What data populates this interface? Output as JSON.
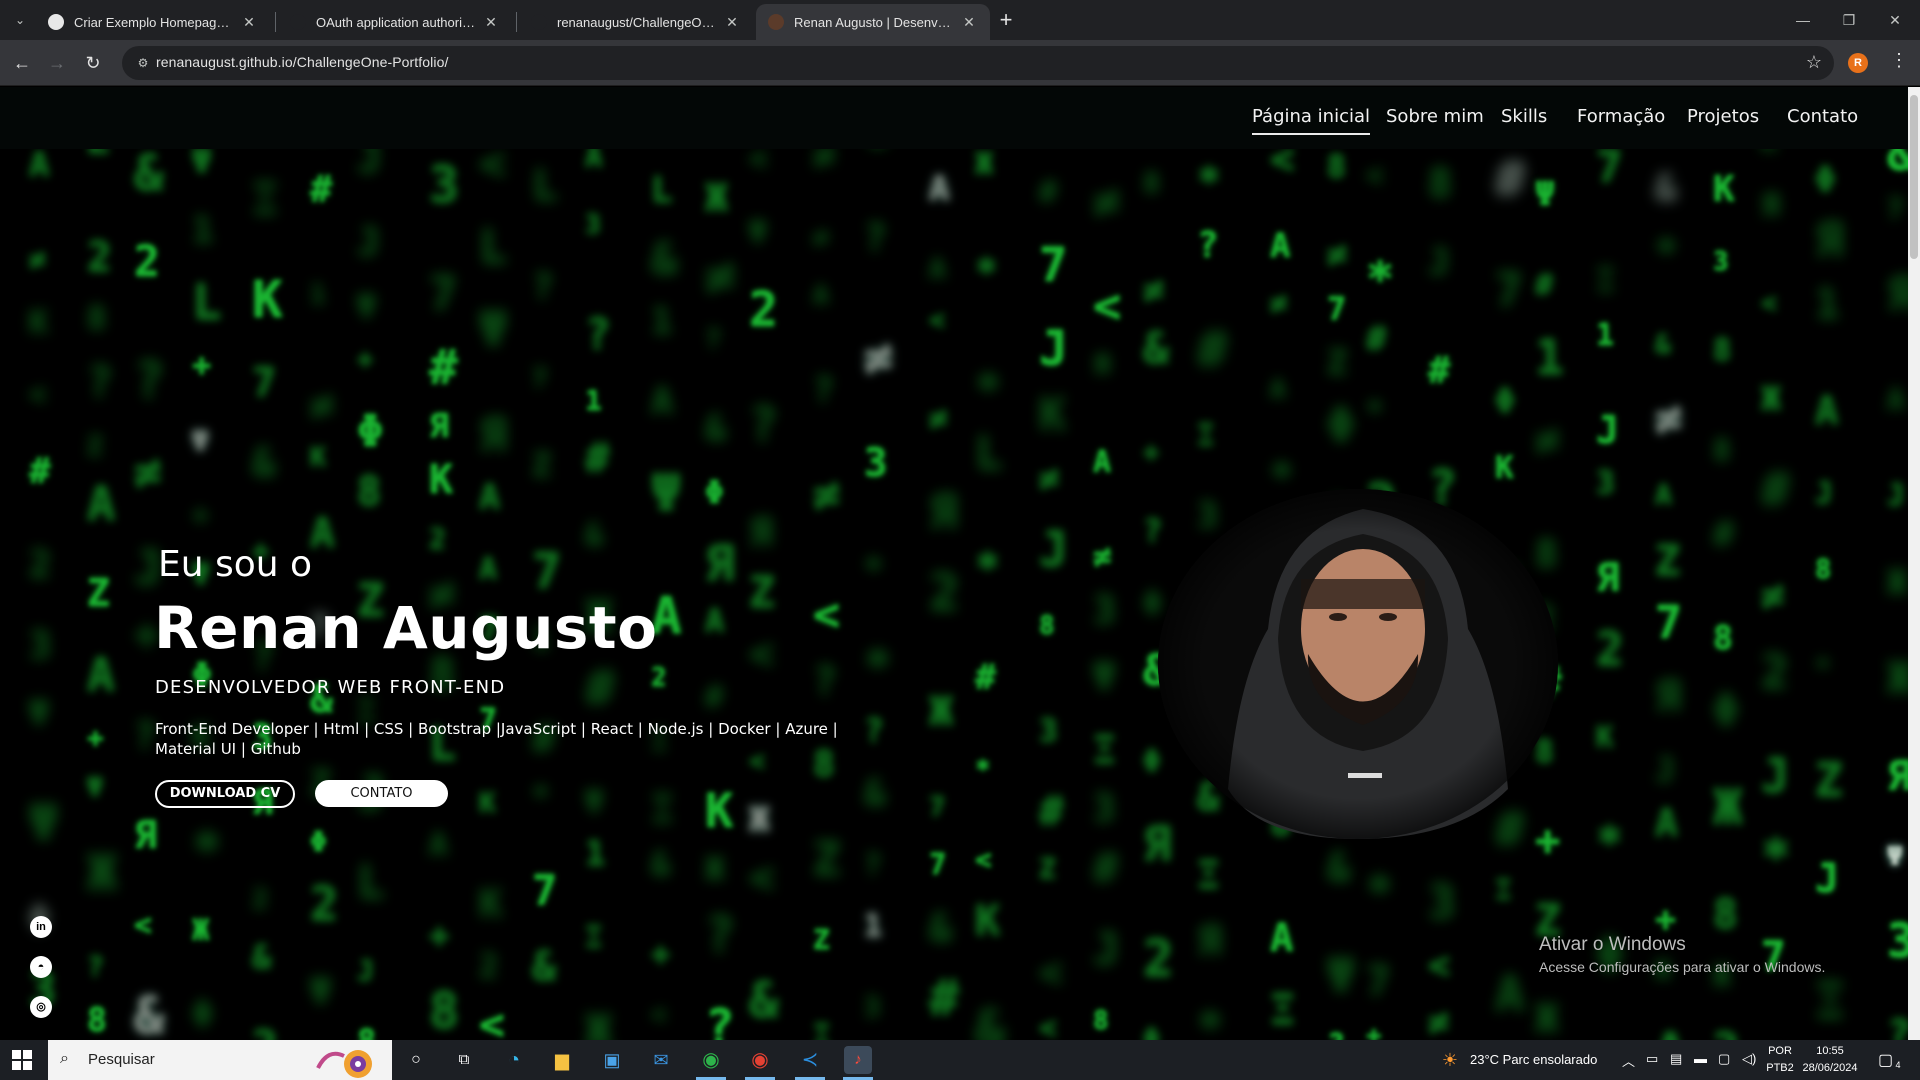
{
  "browser": {
    "tabs": [
      {
        "title": "Criar Exemplo Homepage Code",
        "favicon_color": "#e8e8e8"
      },
      {
        "title": "OAuth application authorized",
        "favicon_color": "#202124"
      },
      {
        "title": "renanaugust/ChallengeOne-Po",
        "favicon_color": "#202124"
      },
      {
        "title": "Renan Augusto | Desenvolvedo",
        "favicon_color": "#5b3b2a",
        "active": true
      }
    ],
    "new_tab_label": "+",
    "url": "renanaugust.github.io/ChallengeOne-Portfolio/",
    "profile_initial": "R"
  },
  "site": {
    "nav": [
      "Página inicial",
      "Sobre mim",
      "Skills",
      "Formação",
      "Projetos",
      "Contato"
    ],
    "active_nav": "Página inicial",
    "hero": {
      "intro": "Eu sou o",
      "name": "Renan Augusto",
      "role": "DESENVOLVEDOR WEB FRONT-END",
      "skills": "Front-End Developer | Html | CSS | Bootstrap |JavaScript | React | Node.js | Docker | Azure | Material UI | Github",
      "download_cv": "DOWNLOAD CV",
      "contact": "CONTATO"
    },
    "social": [
      "linkedin-icon",
      "github-icon",
      "instagram-icon"
    ],
    "accent_color": "#1fd33a"
  },
  "windows_activation": {
    "title": "Ativar o Windows",
    "subtitle": "Acesse Configurações para ativar o Windows."
  },
  "taskbar": {
    "search_placeholder": "Pesquisar",
    "weather": "23°C  Parc ensolarado",
    "language": "POR",
    "layout": "PTB2",
    "time": "10:55",
    "date": "28/06/2024",
    "notification_count": "4"
  }
}
